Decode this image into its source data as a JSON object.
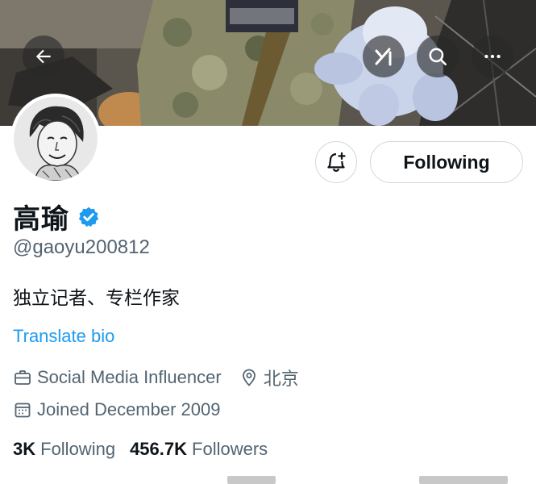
{
  "header": {
    "back_icon": "arrow-left-icon",
    "grok_icon": "grok-icon",
    "search_icon": "search-icon",
    "more_icon": "more-horizontal-icon"
  },
  "profile": {
    "name": "高瑜",
    "verified": true,
    "handle": "@gaoyu200812",
    "bio": "独立记者、专栏作家",
    "translate_label": "Translate bio",
    "category": "Social Media Influencer",
    "location": "北京",
    "joined": "Joined December 2009",
    "following_count": "3K",
    "following_label": "Following",
    "followers_count": "456.7K",
    "followers_label": "Followers"
  },
  "actions": {
    "notify_icon": "bell-plus-icon",
    "follow_button_label": "Following"
  },
  "colors": {
    "accent": "#1d9bf0",
    "secondary_text": "#536471",
    "primary_text": "#0f1419",
    "border": "#cfd9de"
  }
}
